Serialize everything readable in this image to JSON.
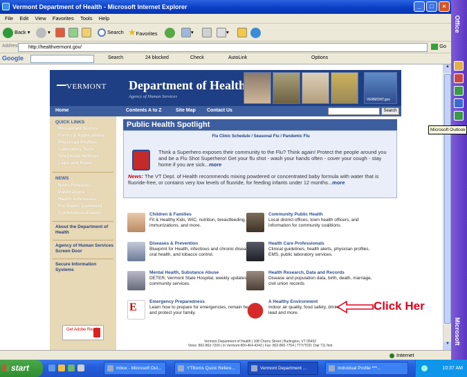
{
  "window": {
    "title": "Vermont Department of Health - Microsoft Internet Explorer"
  },
  "menu": [
    "File",
    "Edit",
    "View",
    "Favorites",
    "Tools",
    "Help"
  ],
  "toolbar": {
    "back": "Back",
    "search": "Search",
    "favorites": "Favorites"
  },
  "address": {
    "label": "Address",
    "url": "http://healthvermont.gov/",
    "go": "Go"
  },
  "google_bar": {
    "logo": "Google",
    "search": "Search",
    "blocked": "24 blocked",
    "check": "Check",
    "autolink": "AutoLink",
    "options": "Options"
  },
  "site": {
    "logo_text": "VERMONT",
    "dept_title": "Department of Health",
    "agency": "Agency of Human Services",
    "photo_caption": "VERMONT.gov",
    "nav": [
      "Home",
      "Contents A to Z",
      "Site Map",
      "Contact Us"
    ],
    "search_button": "Search",
    "quick_links_heading": "QUICK LINKS",
    "quick_links": [
      "Restaurant Scores",
      "Forms & Applications",
      "Physician Profiles",
      "Laboratory Tests",
      "Telephone Hotlines",
      "Laws and Rules"
    ],
    "news_heading": "NEWS",
    "news_links": [
      "News Releases",
      "Publications",
      "Health Advisories",
      "For Public Comment",
      "Conferences/Events"
    ],
    "side_sections": [
      "About the Department of Health",
      "Agency of Human Services Screen Door",
      "Secure Information Systems"
    ],
    "reader_label": "Get Adobe Reader",
    "spotlight_title": "Public Health Spotlight",
    "spotlight_links": "Flu Clinic Schedule / Seasonal Flu / Pandemic Flu",
    "spotlight_text": "Think a Superhero exposes their community to the Flu? Think again! Protect the people around you and be a Flu Shot Superhero! Get your flu shot - wash your hands often - cover your cough - stay home if you are sick...",
    "spotlight_more": "more",
    "news_label": "News:",
    "news_text": "The VT Dept. of Health recommends mixing powdered or concentrated baby formula with water that is fluoride-free, or contains very low levels of fluoride, for feeding infants under 12 months...",
    "news_more": "more",
    "categories": [
      {
        "title": "Children & Families",
        "desc": "Fit & Healthy Kids, WIC, nutrition, breastfeeding, immunizations, and more."
      },
      {
        "title": "Community Public Health",
        "desc": "Local district offices, town health officers, and information for community coalitions."
      },
      {
        "title": "Diseases & Prevention",
        "desc": "Blueprint for Health, infectious and chronic disease, oral health, and tobacco control."
      },
      {
        "title": "Health Care Professionals",
        "desc": "Clinical guidelines, health alerts, physician profiles, EMS, public laboratory services."
      },
      {
        "title": "Mental Health, Substance Abuse",
        "desc": "DETER, Vermont State Hospital, weekly updates, and community services."
      },
      {
        "title": "Health Research, Data and Records",
        "desc": "Disease and population data, birth, death, marriage, civil union records"
      },
      {
        "title": "Emergency Preparedness",
        "desc": "Learn how to prepare for emergencies, remain healthy and protect your family."
      },
      {
        "title": "A Healthy Environment",
        "desc": "Indoor air quality, food safety, drinking water, asbestos, lead and more."
      }
    ],
    "footer1": "Vermont Department of Health | 108 Cherry Street | Burlington, VT 05402",
    "footer2": "Voice: 802-863-7200 | In Vermont 800-464-4343 | Fax: 802-865-7754 | TTY/TDD: Dial 711 first"
  },
  "callout": "Click Her",
  "office_bar": {
    "label_top": "Office",
    "label_bottom": "Microsoft",
    "tooltip": "Microsoft Outlook"
  },
  "status": {
    "zone": "Internet"
  },
  "taskbar": {
    "start": "start",
    "apps": [
      "Inbox - Microsoft Out...",
      "YTBoms Quick Refere...",
      "Vermont Department ...",
      "Individual Profile ***..."
    ],
    "clock": "10:37 AM"
  }
}
